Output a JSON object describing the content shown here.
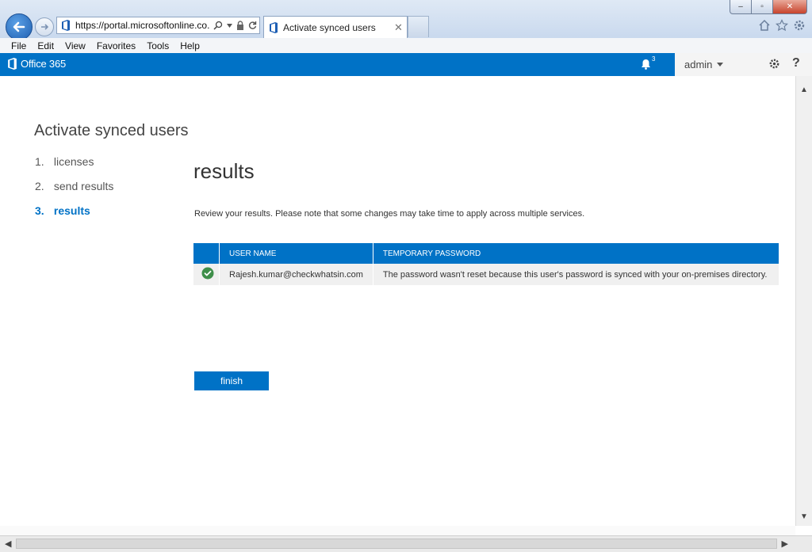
{
  "browser": {
    "url": "https://portal.microsoftonline.co...",
    "tab_title": "Activate synced users",
    "menu": [
      "File",
      "Edit",
      "View",
      "Favorites",
      "Tools",
      "Help"
    ],
    "window_controls": {
      "minimize": "–",
      "restore": "▫",
      "close": "✕"
    }
  },
  "topbar": {
    "brand": "Office 365",
    "notification_count": "3",
    "user": "admin",
    "help": "?"
  },
  "wizard": {
    "title": "Activate synced users",
    "steps": [
      {
        "num": "1.",
        "label": "licenses",
        "active": false
      },
      {
        "num": "2.",
        "label": "send results",
        "active": false
      },
      {
        "num": "3.",
        "label": "results",
        "active": true
      }
    ]
  },
  "results": {
    "heading": "results",
    "note": "Review your results. Please note that some changes may take time to apply across multiple services.",
    "columns": [
      "USER NAME",
      "TEMPORARY PASSWORD"
    ],
    "rows": [
      {
        "user": "Rajesh.kumar@checkwhatsin.com",
        "password": "The password wasn't reset because this user's password is synced with your on-premises directory.",
        "status": "success"
      }
    ],
    "finish_label": "finish"
  },
  "colors": {
    "brand_blue": "#0072c6",
    "success_green": "#3f8f4a"
  }
}
